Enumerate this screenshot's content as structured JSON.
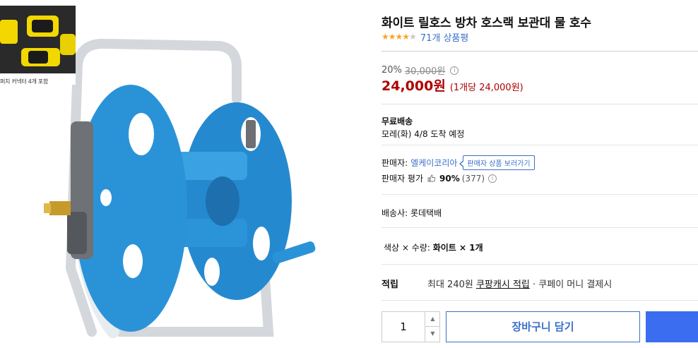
{
  "product": {
    "title": "화이트 릴호스 방차 호스랙 보관대 물 호수",
    "rating_stars": 4,
    "rating_max": 5,
    "review_count_text": "71개 상품평"
  },
  "image": {
    "inset_caption": "퍼치 커넥터 4개 포함"
  },
  "pricing": {
    "discount_rate": "20%",
    "original_price": "30,000원",
    "sale_price": "24,000원",
    "unit_price": "(1개당 24,000원)"
  },
  "shipping": {
    "label": "무료배송",
    "arrival": "모레(화) 4/8 도착 예정"
  },
  "seller": {
    "label": "판매자:",
    "name": "엘케이코리아",
    "tooltip": "판매자 상품 보러가기",
    "rating_label": "판매자 평가",
    "rating_score": "90%",
    "rating_count": "(377)"
  },
  "courier": {
    "text": "배송사: 롯데택배"
  },
  "option": {
    "label": "색상 × 수량: ",
    "value": "화이트 × 1개"
  },
  "reward": {
    "label": "적립",
    "prefix": "최대 240원 ",
    "link": "쿠팡캐시 적립",
    "suffix": " · 쿠페이 머니 결제시"
  },
  "purchase": {
    "quantity": "1",
    "cart_button": "장바구니 담기"
  },
  "colors": {
    "accent_blue": "#3a6fc9",
    "buy_blue": "#3b6df0",
    "price_red": "#ae0000",
    "star": "#f5a623",
    "reel_blue": "#2a93d8"
  },
  "icons": [
    "info-icon",
    "thumbs-up-icon",
    "chevron-up-icon",
    "chevron-down-icon",
    "star-icon"
  ]
}
